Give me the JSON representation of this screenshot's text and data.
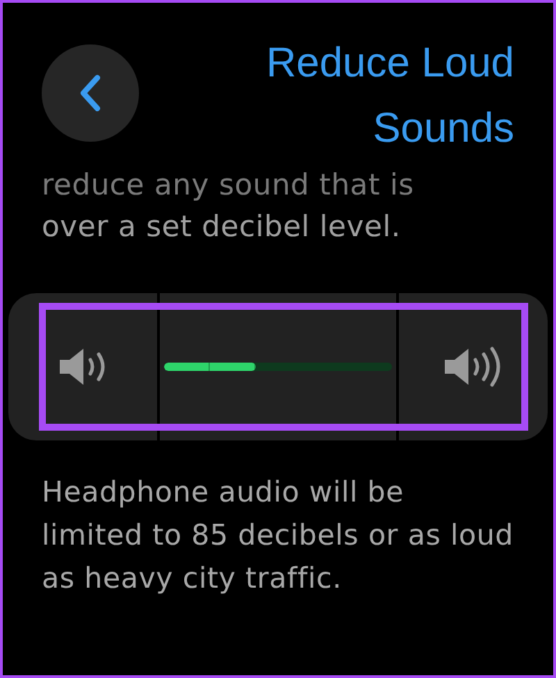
{
  "header": {
    "title": "Reduce Loud Sounds"
  },
  "intro": [
    {
      "text": "reduce any sound that is",
      "faded": true
    },
    {
      "text": "over a set decibel level.",
      "faded": false
    }
  ],
  "volume_slider": {
    "level": 0.4
  },
  "footnote": "Headphone audio will be limited to 85 decibels or as loud as heavy city traffic."
}
